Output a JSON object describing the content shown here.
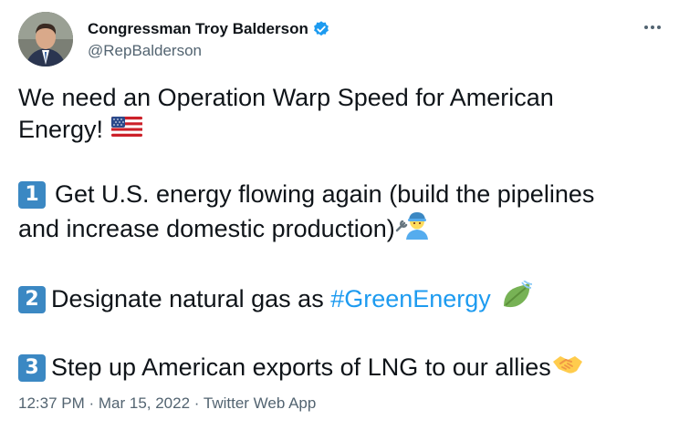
{
  "author": {
    "display_name": "Congressman Troy Balderson",
    "handle": "@RepBalderson",
    "verified": true,
    "avatar_icon": "profile-photo"
  },
  "tweet": {
    "line1": "We need an Operation Warp Speed for American",
    "line2_text": "Energy!",
    "item1_keycap": "1",
    "item1_line1": "Get U.S. energy flowing again (build the pipelines",
    "item1_line2": "and increase domestic production)",
    "item2_keycap": "2",
    "item2_text": "Designate natural gas as ",
    "item2_hashtag": "#GreenEnergy",
    "item3_keycap": "3",
    "item3_text": "Step up American exports of LNG to our allies"
  },
  "meta": {
    "time": "12:37 PM",
    "sep1": " · ",
    "date": "Mar 15, 2022",
    "sep2": " · ",
    "source": "Twitter Web App"
  },
  "colors": {
    "link": "#1d9bf0",
    "text": "#0f1419",
    "muted": "#536471",
    "keycap": "#3b88c3"
  },
  "icons": {
    "flag": "us-flag-icon",
    "mechanic": "mechanic-emoji-icon",
    "leaf": "leaf-wind-icon",
    "handshake": "handshake-icon",
    "more": "more-options-icon",
    "verified": "verified-badge-icon"
  }
}
